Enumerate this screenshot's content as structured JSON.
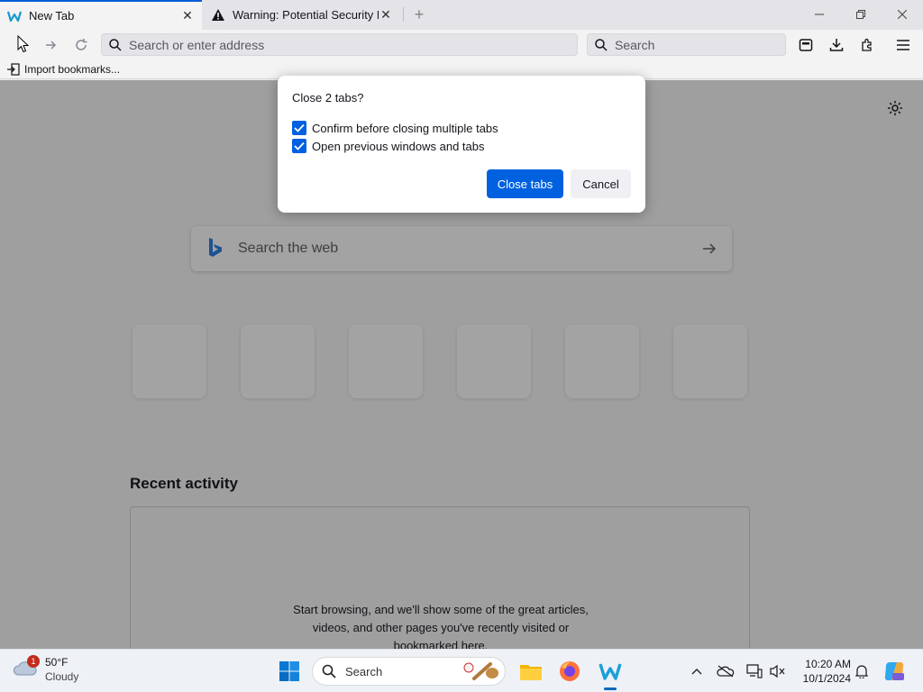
{
  "tabs": [
    {
      "title": "New Tab",
      "favicon": "waterfox-icon",
      "active": true
    },
    {
      "title": "Warning: Potential Security Risk Ahead",
      "favicon": "warning-icon",
      "active": false
    }
  ],
  "navbar": {
    "url_placeholder": "Search or enter address",
    "search_placeholder": "Search"
  },
  "bookmarks": {
    "import_label": "Import bookmarks..."
  },
  "newtab": {
    "web_search_placeholder": "Search the web",
    "recent_title": "Recent activity",
    "recent_empty_line1": "Start browsing, and we'll show some of the great articles,",
    "recent_empty_line2": "videos, and other pages you've recently visited or",
    "recent_empty_line3": "bookmarked here."
  },
  "dialog": {
    "title": "Close 2 tabs?",
    "checkbox1": {
      "label": "Confirm before closing multiple tabs",
      "checked": true
    },
    "checkbox2": {
      "label": "Open previous windows and tabs",
      "checked": true
    },
    "primary_button": "Close tabs",
    "secondary_button": "Cancel"
  },
  "taskbar": {
    "weather_temp": "50°F",
    "weather_cond": "Cloudy",
    "weather_badge": "1",
    "search_label": "Search",
    "time": "10:20 AM",
    "date": "10/1/2024"
  },
  "colors": {
    "accent": "#0061e0",
    "dim_overlay": "rgba(12,12,13,0.38)"
  }
}
